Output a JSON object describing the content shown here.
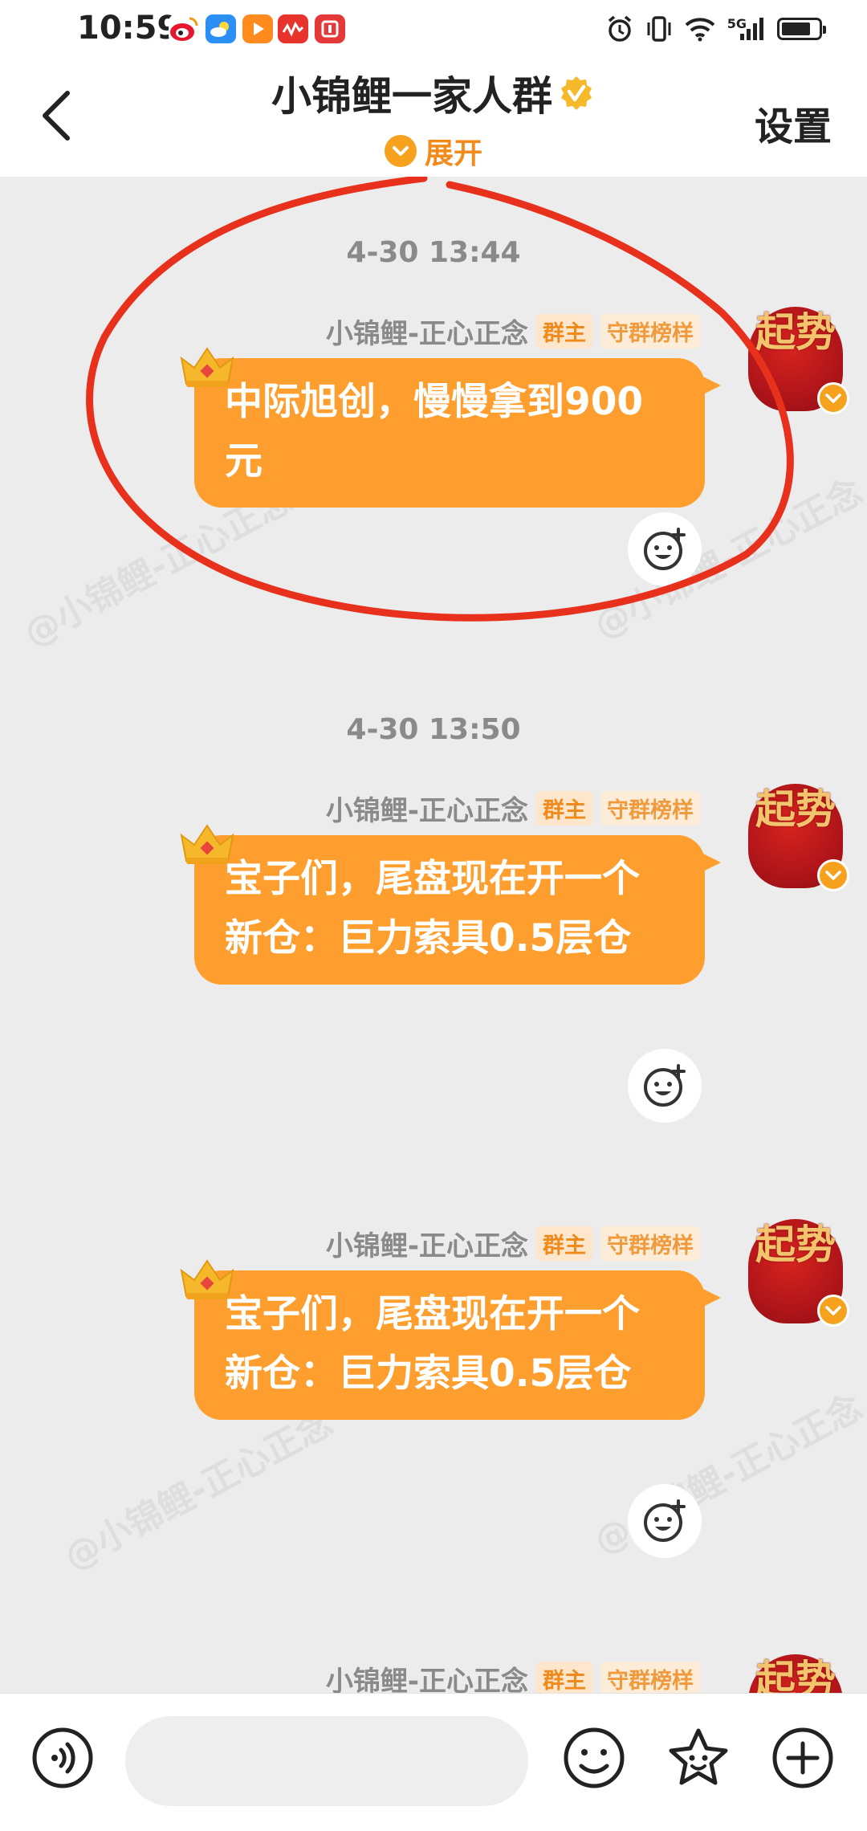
{
  "status_bar": {
    "time": "10:59",
    "network": "5G",
    "battery_level": 0.8,
    "app_icons": [
      "weibo-icon",
      "weather-icon",
      "video-icon",
      "music-icon",
      "news-icon"
    ],
    "app_colors": [
      "#e6162d",
      "#2b8ff6",
      "#ff8a1d",
      "#e8322c",
      "#e53838"
    ]
  },
  "header": {
    "title": "小锦鲤一家人群",
    "expand_label": "展开",
    "settings_label": "设置"
  },
  "messages": [
    {
      "timestamp": "4-30 13:44",
      "sender": "小锦鲤-正心正念",
      "tags": [
        "群主",
        "守群榜样"
      ],
      "text": "中际旭创，慢慢拿到900元",
      "avatar_text": "起势"
    },
    {
      "timestamp": "4-30 13:50",
      "sender": "小锦鲤-正心正念",
      "tags": [
        "群主",
        "守群榜样"
      ],
      "text": "宝子们，尾盘现在开一个新仓：巨力索具0.5层仓",
      "avatar_text": "起势"
    },
    {
      "sender": "小锦鲤-正心正念",
      "tags": [
        "群主",
        "守群榜样"
      ],
      "text": "宝子们，尾盘现在开一个新仓：巨力索具0.5层仓",
      "avatar_text": "起势"
    },
    {
      "sender": "小锦鲤-正心正念",
      "tags": [
        "群主",
        "守群榜样"
      ],
      "avatar_text": "起势"
    }
  ],
  "watermark": "@小锦鲤-正心正念",
  "input_bar": {
    "placeholder": "",
    "icons": [
      "voice-icon",
      "emoji-icon",
      "sticker-icon",
      "plus-icon"
    ]
  },
  "colors": {
    "accent": "#fe9e2e",
    "annotation": "#e8311c",
    "background": "#ececec"
  }
}
